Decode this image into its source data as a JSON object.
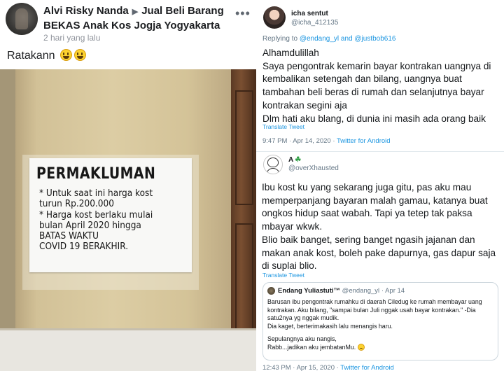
{
  "facebook_post": {
    "author": "Alvi Risky Nanda",
    "group": "Jual Beli Barang BEKAS Anak Kos Jogja Yogyakarta",
    "timestamp": "2 hari yang lalu",
    "more_icon": "•••",
    "caption": "Ratakann",
    "caption_emoji": [
      "grinning-face-emoji",
      "grinning-face-emoji"
    ],
    "photo": {
      "notice_title": "PERMAKLUMAN",
      "notice_lines": [
        "* Untuk saat ini harga kost",
        "  turun Rp.200.000",
        "* Harga kost berlaku mulai",
        "  bulan April 2020 hingga",
        "  BATAS WAKTU",
        "  COVID 19 BERAKHIR."
      ]
    }
  },
  "twitter_thread": {
    "tweet1": {
      "display_name": "icha sentut",
      "handle": "@icha_412135",
      "replying_prefix": "Replying to",
      "replying_to": "@endang_yl and @justbob616",
      "lines": [
        "Alhamdulillah",
        "Saya pengontrak kemarin bayar kontrakan uangnya di",
        "kembalikan setengah dan bilang, uangnya buat",
        "tambahan beli beras di rumah dan selanjutnya bayar",
        "kontrakan segini aja",
        "Dlm hati aku blang, di dunia ini masih ada orang baik"
      ],
      "translate": "Translate Tweet",
      "time": "9:47 PM · Apr 14, 2020 · ",
      "source": "Twitter for Android"
    },
    "tweet2": {
      "display_name": "A",
      "name_emoji": "☘",
      "handle": "@overXhausted",
      "lines": [
        "Ibu kost ku yang sekarang juga gitu, pas aku mau",
        "memperpanjang bayaran malah gamau, katanya buat",
        "ongkos hidup saat wabah. Tapi ya tetep tak paksa",
        "mbayar wkwk.",
        "Blio baik banget, sering banget ngasih jajanan dan",
        "makan anak kost, boleh pake dapurnya, gas dapur saja",
        "di suplai blio."
      ],
      "translate": "Translate Tweet",
      "quoted": {
        "name": "Endang Yuliastuti™",
        "handle": "@endang_yl",
        "date": "· Apr 14",
        "paragraph1": [
          "Barusan ibu pengontrak rumahku di daerah Ciledug ke rumah membayar uang",
          "kontrakan. Aku bilang, \"sampai bulan Juli nggak usah bayar kontrakan.\" -Dia",
          "satu2nya yg nggak mudik.",
          "Dia kaget, berterimakasih lalu menangis haru."
        ],
        "paragraph2": [
          "Sepulangnya aku nangis,",
          "Rabb...jadikan aku jembatanMu."
        ]
      },
      "time": "12:43 PM · Apr 15, 2020 · ",
      "source": "Twitter for Android"
    }
  }
}
